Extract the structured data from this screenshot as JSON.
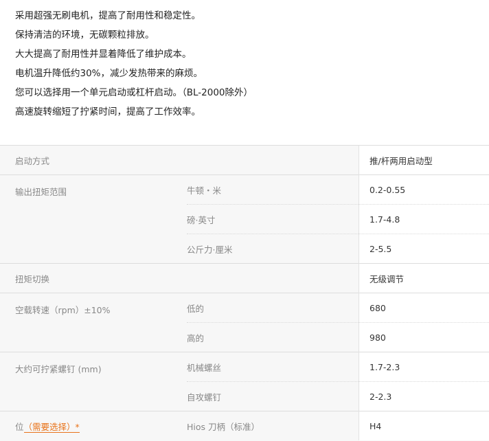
{
  "features": [
    "采用超强无刷电机，提高了耐用性和稳定性。",
    "保持清洁的环境，无碳颗粒排放。",
    "大大提高了耐用性并显着降低了维护成本。",
    "电机温升降低约30%，减少发热带来的麻烦。",
    "您可以选择用一个单元启动或杠杆启动。（BL-2000除外）",
    "高速旋转缩短了拧紧时间，提高了工作效率。"
  ],
  "specs": {
    "start_method": {
      "label": "启动方式",
      "value": "推/杆两用启动型"
    },
    "torque_range": {
      "label": "输出扭矩范围",
      "rows": [
        {
          "unit": "牛顿・米",
          "value": "0.2-0.55"
        },
        {
          "unit": "磅·英寸",
          "value": "1.7-4.8"
        },
        {
          "unit": "公斤力·厘米",
          "value": "2-5.5"
        }
      ]
    },
    "torque_switch": {
      "label": "扭矩切换",
      "value": "无级调节"
    },
    "idle_speed": {
      "label": "空载转速（rpm）±10%",
      "rows": [
        {
          "unit": "低的",
          "value": "680"
        },
        {
          "unit": "高的",
          "value": "980"
        }
      ]
    },
    "screw_size": {
      "label": "大约可拧紧螺钉 (mm)",
      "rows": [
        {
          "unit": "机械螺丝",
          "value": "1.7-2.3"
        },
        {
          "unit": "自攻螺钉",
          "value": "2-2.3"
        }
      ]
    },
    "bit": {
      "label": "位",
      "required_link": "（需要选择）*",
      "unit": "Hios 刀柄（标准）",
      "value": "H4"
    }
  },
  "colors": {
    "accent": "#e8731a",
    "label_text": "#888888",
    "value_text": "#333333",
    "table_bg": "#f7f7f7"
  }
}
